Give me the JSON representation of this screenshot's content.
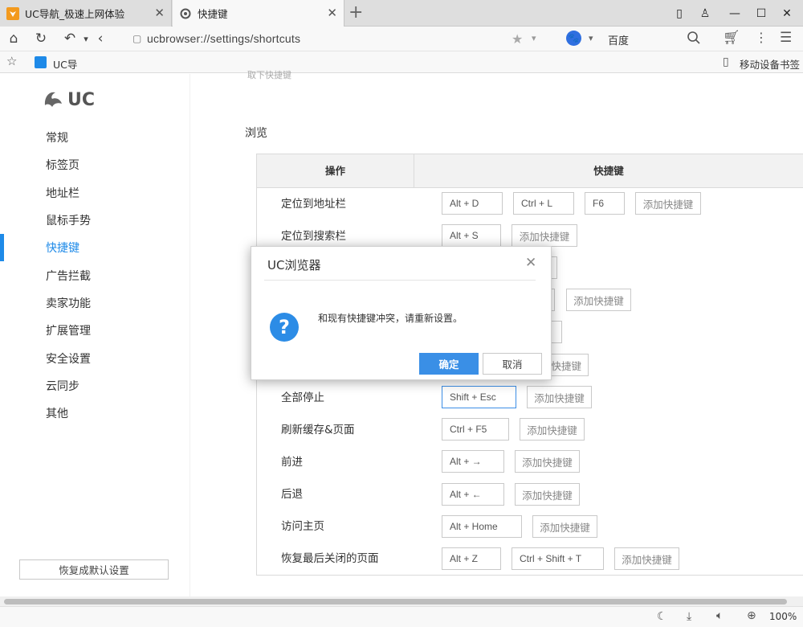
{
  "tabs": [
    {
      "title": "UC导航_极速上网体验",
      "icon": "uc-navigation-icon"
    },
    {
      "title": "快捷键",
      "icon": "settings-gear-icon"
    }
  ],
  "address": {
    "url": "ucbrowser://settings/shortcuts",
    "search_engine": "百度"
  },
  "bookmarks": {
    "first_item": "UC导",
    "mobile_bookmarks": "移动设备书签"
  },
  "sidebar": {
    "logo_text": "UC",
    "items": [
      {
        "label": "常规"
      },
      {
        "label": "标签页"
      },
      {
        "label": "地址栏"
      },
      {
        "label": "鼠标手势"
      },
      {
        "label": "快捷键",
        "active": true
      },
      {
        "label": "广告拦截"
      },
      {
        "label": "卖家功能"
      },
      {
        "label": "扩展管理"
      },
      {
        "label": "安全设置"
      },
      {
        "label": "云同步"
      },
      {
        "label": "其他"
      }
    ],
    "reset_label": "恢复成默认设置"
  },
  "main": {
    "section_title": "浏览",
    "partial_top_text": "取下快捷键",
    "table": {
      "headers": [
        "操作",
        "快捷键"
      ],
      "add_label": "添加快捷键",
      "rows": [
        {
          "action": "定位到地址栏",
          "keys": [
            "Alt + D",
            "Ctrl + L",
            "F6"
          ]
        },
        {
          "action": "定位到搜索栏",
          "keys": [
            "Alt + S"
          ]
        },
        {
          "action": "",
          "keys": []
        },
        {
          "action": "",
          "keys": []
        },
        {
          "action": "",
          "keys": []
        },
        {
          "action": "",
          "keys": []
        },
        {
          "action": "全部停止",
          "keys": [
            "Shift + Esc"
          ]
        },
        {
          "action": "刷新缓存&页面",
          "keys": [
            "Ctrl + F5"
          ]
        },
        {
          "action": "前进",
          "keys": [
            "Alt + →"
          ]
        },
        {
          "action": "后退",
          "keys": [
            "Alt + ←"
          ]
        },
        {
          "action": "访问主页",
          "keys": [
            "Alt + Home"
          ]
        },
        {
          "action": "恢复最后关闭的页面",
          "keys": [
            "Alt + Z",
            "Ctrl + Shift + T"
          ]
        }
      ]
    }
  },
  "dialog": {
    "title": "UC浏览器",
    "message": "和现有快捷键冲突，请重新设置。",
    "ok_label": "确定",
    "cancel_label": "取消",
    "icon": "question-icon"
  },
  "status": {
    "zoom": "100%"
  },
  "colors": {
    "accent": "#1e8ae8",
    "uc_orange": "#f39a1e"
  }
}
